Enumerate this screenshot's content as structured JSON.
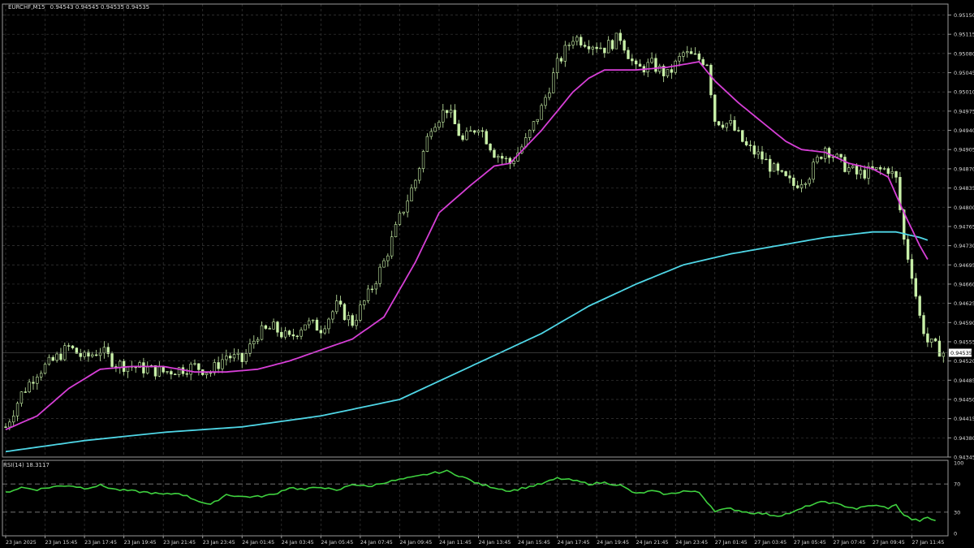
{
  "header": {
    "symbol_timeframe": "EURCHF,M15",
    "ohlc": "0.94543 0.94545 0.94535 0.94535"
  },
  "colors": {
    "background": "#000000",
    "grid": "#3a3a3a",
    "candle": "#c8f0a8",
    "ma_fast": "#d63fd6",
    "ma_slow": "#4fd6e6",
    "rsi": "#3fd13f",
    "axis_text": "#d8d8d8"
  },
  "chart_data": [
    {
      "type": "candlestick",
      "name": "price",
      "y_ticks": [
        "0.95150",
        "0.95115",
        "0.95080",
        "0.95045",
        "0.95010",
        "0.94975",
        "0.94940",
        "0.94905",
        "0.94870",
        "0.94835",
        "0.94800",
        "0.94765",
        "0.94730",
        "0.94695",
        "0.94660",
        "0.94625",
        "0.94590",
        "0.94555",
        "0.94520",
        "0.94485",
        "0.94450",
        "0.94415",
        "0.94380",
        "0.94345"
      ],
      "ylim": [
        0.94345,
        0.9517
      ],
      "last_price_label": "0.94535",
      "last_price": 0.94535,
      "x_ticks": [
        "23 Jan 2025",
        "23 Jan 15:45",
        "23 Jan 17:45",
        "23 Jan 19:45",
        "23 Jan 21:45",
        "23 Jan 23:45",
        "24 Jan 01:45",
        "24 Jan 03:45",
        "24 Jan 05:45",
        "24 Jan 07:45",
        "24 Jan 09:45",
        "24 Jan 11:45",
        "24 Jan 13:45",
        "24 Jan 15:45",
        "24 Jan 17:45",
        "24 Jan 19:45",
        "24 Jan 21:45",
        "24 Jan 23:45",
        "27 Jan 01:45",
        "27 Jan 03:45",
        "27 Jan 05:45",
        "27 Jan 07:45",
        "27 Jan 09:45",
        "27 Jan 11:45"
      ],
      "close_path": [
        [
          0,
          0.944
        ],
        [
          4,
          0.9446
        ],
        [
          8,
          0.945
        ],
        [
          12,
          0.9452
        ],
        [
          16,
          0.94545
        ],
        [
          20,
          0.94525
        ],
        [
          24,
          0.9454
        ],
        [
          28,
          0.94515
        ],
        [
          32,
          0.9451
        ],
        [
          36,
          0.94505
        ],
        [
          40,
          0.945
        ],
        [
          44,
          0.94505
        ],
        [
          48,
          0.9451
        ],
        [
          52,
          0.945
        ],
        [
          56,
          0.9453
        ],
        [
          60,
          0.9452
        ],
        [
          64,
          0.9457
        ],
        [
          68,
          0.9458
        ],
        [
          72,
          0.9456
        ],
        [
          76,
          0.9459
        ],
        [
          80,
          0.9458
        ],
        [
          84,
          0.9462
        ],
        [
          88,
          0.9459
        ],
        [
          92,
          0.9464
        ],
        [
          96,
          0.947
        ],
        [
          100,
          0.9478
        ],
        [
          104,
          0.9485
        ],
        [
          108,
          0.9495
        ],
        [
          112,
          0.9498
        ],
        [
          116,
          0.9492
        ],
        [
          120,
          0.9495
        ],
        [
          124,
          0.949
        ],
        [
          128,
          0.9488
        ],
        [
          132,
          0.9492
        ],
        [
          136,
          0.9498
        ],
        [
          140,
          0.9506
        ],
        [
          144,
          0.9511
        ],
        [
          148,
          0.951
        ],
        [
          152,
          0.9509
        ],
        [
          156,
          0.9511
        ],
        [
          160,
          0.9505
        ],
        [
          164,
          0.9506
        ],
        [
          168,
          0.9504
        ],
        [
          172,
          0.9508
        ],
        [
          176,
          0.9507
        ],
        [
          178,
          0.95065
        ],
        [
          180,
          0.9496
        ],
        [
          184,
          0.9495
        ],
        [
          188,
          0.9491
        ],
        [
          192,
          0.9489
        ],
        [
          196,
          0.9486
        ],
        [
          200,
          0.9484
        ],
        [
          204,
          0.9486
        ],
        [
          208,
          0.9491
        ],
        [
          212,
          0.9488
        ],
        [
          216,
          0.9486
        ],
        [
          220,
          0.94865
        ],
        [
          224,
          0.9487
        ],
        [
          226,
          0.9485
        ],
        [
          228,
          0.9474
        ],
        [
          230,
          0.9468
        ],
        [
          232,
          0.946
        ],
        [
          234,
          0.94555
        ],
        [
          236,
          0.94545
        ],
        [
          238,
          0.94535
        ]
      ],
      "ma_fast": [
        [
          0,
          0.94395
        ],
        [
          8,
          0.9442
        ],
        [
          16,
          0.9447
        ],
        [
          24,
          0.94505
        ],
        [
          32,
          0.9451
        ],
        [
          40,
          0.9451
        ],
        [
          48,
          0.945
        ],
        [
          56,
          0.945
        ],
        [
          64,
          0.94505
        ],
        [
          72,
          0.9452
        ],
        [
          80,
          0.9454
        ],
        [
          88,
          0.9456
        ],
        [
          96,
          0.946
        ],
        [
          104,
          0.947
        ],
        [
          110,
          0.9479
        ],
        [
          118,
          0.9484
        ],
        [
          124,
          0.94875
        ],
        [
          128,
          0.9488
        ],
        [
          136,
          0.9494
        ],
        [
          144,
          0.9501
        ],
        [
          148,
          0.95035
        ],
        [
          152,
          0.9505
        ],
        [
          160,
          0.9505
        ],
        [
          168,
          0.95055
        ],
        [
          176,
          0.95065
        ],
        [
          180,
          0.9503
        ],
        [
          186,
          0.9499
        ],
        [
          192,
          0.94955
        ],
        [
          198,
          0.9492
        ],
        [
          202,
          0.94905
        ],
        [
          208,
          0.949
        ],
        [
          214,
          0.9488
        ],
        [
          220,
          0.9487
        ],
        [
          224,
          0.94855
        ],
        [
          228,
          0.9479
        ],
        [
          232,
          0.9473
        ],
        [
          234,
          0.94705
        ]
      ],
      "ma_slow": [
        [
          0,
          0.94355
        ],
        [
          20,
          0.94375
        ],
        [
          40,
          0.9439
        ],
        [
          60,
          0.944
        ],
        [
          80,
          0.9442
        ],
        [
          100,
          0.9445
        ],
        [
          112,
          0.9449
        ],
        [
          124,
          0.9453
        ],
        [
          136,
          0.9457
        ],
        [
          148,
          0.9462
        ],
        [
          160,
          0.9466
        ],
        [
          172,
          0.94695
        ],
        [
          184,
          0.94715
        ],
        [
          196,
          0.9473
        ],
        [
          208,
          0.94745
        ],
        [
          220,
          0.94755
        ],
        [
          226,
          0.94755
        ],
        [
          232,
          0.94745
        ],
        [
          234,
          0.9474
        ]
      ]
    },
    {
      "type": "line",
      "name": "RSI(14)",
      "title": "RSI(14) 18.3117",
      "y_ticks": [
        "100",
        "70",
        "30",
        "0"
      ],
      "ylim": [
        0,
        100
      ],
      "levels": [
        70,
        30
      ],
      "values": [
        [
          0,
          58
        ],
        [
          4,
          65
        ],
        [
          8,
          62
        ],
        [
          12,
          66
        ],
        [
          16,
          68
        ],
        [
          20,
          64
        ],
        [
          24,
          68
        ],
        [
          28,
          62
        ],
        [
          32,
          60
        ],
        [
          36,
          58
        ],
        [
          40,
          55
        ],
        [
          44,
          57
        ],
        [
          48,
          48
        ],
        [
          50,
          44
        ],
        [
          52,
          40
        ],
        [
          54,
          48
        ],
        [
          56,
          55
        ],
        [
          60,
          52
        ],
        [
          64,
          52
        ],
        [
          68,
          55
        ],
        [
          72,
          65
        ],
        [
          76,
          62
        ],
        [
          80,
          66
        ],
        [
          84,
          60
        ],
        [
          88,
          70
        ],
        [
          92,
          66
        ],
        [
          96,
          72
        ],
        [
          100,
          76
        ],
        [
          104,
          80
        ],
        [
          108,
          85
        ],
        [
          112,
          88
        ],
        [
          116,
          80
        ],
        [
          120,
          70
        ],
        [
          124,
          65
        ],
        [
          128,
          60
        ],
        [
          132,
          65
        ],
        [
          136,
          70
        ],
        [
          140,
          78
        ],
        [
          144,
          75
        ],
        [
          148,
          70
        ],
        [
          152,
          72
        ],
        [
          156,
          68
        ],
        [
          160,
          56
        ],
        [
          164,
          60
        ],
        [
          168,
          55
        ],
        [
          172,
          60
        ],
        [
          176,
          58
        ],
        [
          180,
          32
        ],
        [
          184,
          35
        ],
        [
          188,
          30
        ],
        [
          192,
          28
        ],
        [
          196,
          25
        ],
        [
          200,
          30
        ],
        [
          204,
          40
        ],
        [
          208,
          45
        ],
        [
          212,
          40
        ],
        [
          216,
          35
        ],
        [
          220,
          40
        ],
        [
          224,
          36
        ],
        [
          226,
          40
        ],
        [
          228,
          26
        ],
        [
          230,
          20
        ],
        [
          232,
          18
        ],
        [
          234,
          22
        ],
        [
          236,
          18
        ]
      ]
    }
  ]
}
